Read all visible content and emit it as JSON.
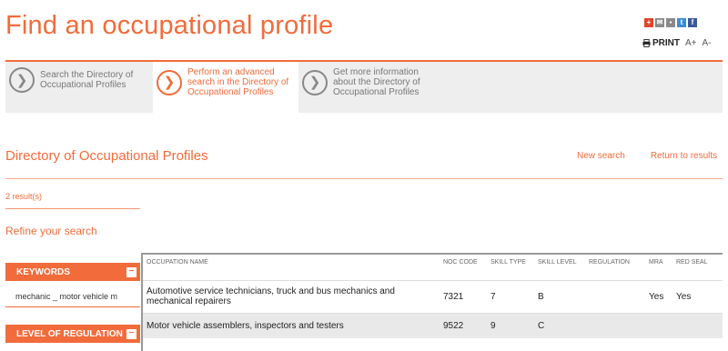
{
  "page": {
    "title": "Find an occupational profile"
  },
  "share": {
    "icons": [
      "plus-icon",
      "email-icon",
      "share-icon",
      "twitter-icon",
      "facebook-icon"
    ],
    "colors": [
      "#e0452b",
      "#8a8a8a",
      "#8a8a8a",
      "#3a8fd8",
      "#3b5998"
    ]
  },
  "tools": {
    "print_label": "PRINT",
    "font_increase": "A+",
    "font_decrease": "A-"
  },
  "steps": [
    {
      "label": "Search the Directory of Occupational Profiles",
      "active": false
    },
    {
      "label": "Perform an advanced search in the Directory of Occupational Profiles",
      "active": true
    },
    {
      "label": "Get more information about the Directory of Occupational Profiles",
      "active": false
    }
  ],
  "directory": {
    "title": "Directory of Occupational Profiles",
    "new_search": "New search",
    "return": "Return to results"
  },
  "results": {
    "count_label": "2 result(s)"
  },
  "refine": {
    "title": "Refine your search"
  },
  "filters": {
    "keywords_label": "KEYWORDS",
    "keywords_value": "mechanic _ motor vehicle m",
    "regulation_label": "LEVEL OF REGULATION"
  },
  "table": {
    "headers": [
      "OCCUPATION NAME",
      "NOC CODE",
      "SKILL TYPE",
      "SKILL LEVEL",
      "REGULATION",
      "MRA",
      "RED SEAL"
    ],
    "rows": [
      [
        "Automotive service technicians, truck and bus mechanics and mechanical repairers",
        "7321",
        "7",
        "B",
        "",
        "Yes",
        "Yes"
      ],
      [
        "Motor vehicle assemblers, inspectors and testers",
        "9522",
        "9",
        "C",
        "",
        "",
        ""
      ]
    ]
  },
  "colors": {
    "accent": "#f26b3a",
    "step_bg": "#eeeeee",
    "row_alt": "#e9e9e9"
  }
}
